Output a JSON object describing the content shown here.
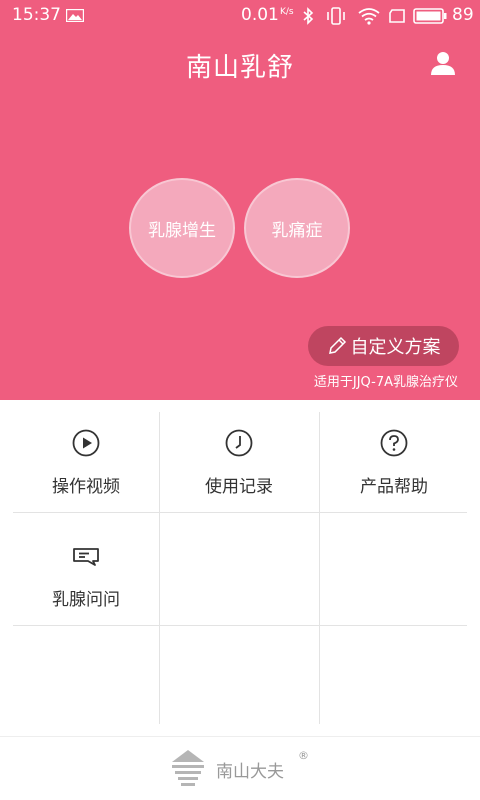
{
  "status_bar": {
    "time": "15:37",
    "net_speed": "0.01",
    "net_unit": "K/s",
    "battery": "89"
  },
  "header": {
    "title": "南山乳舒"
  },
  "programs": [
    {
      "label": "乳腺增生"
    },
    {
      "label": "乳痛症"
    }
  ],
  "custom_plan": {
    "label": "自定义方案"
  },
  "device_note": "适用于JJQ-7A乳腺治疗仪",
  "menu": [
    {
      "label": "操作视频",
      "icon": "play-circle-icon"
    },
    {
      "label": "使用记录",
      "icon": "clock-icon"
    },
    {
      "label": "产品帮助",
      "icon": "question-circle-icon"
    },
    {
      "label": "乳腺问问",
      "icon": "chat-bubble-icon"
    }
  ],
  "footer": {
    "brand": "南山大夫",
    "reg_mark": "®"
  },
  "colors": {
    "primary": "#ef5d7f",
    "circle": "#f4a9bc",
    "button": "#bf4560"
  }
}
